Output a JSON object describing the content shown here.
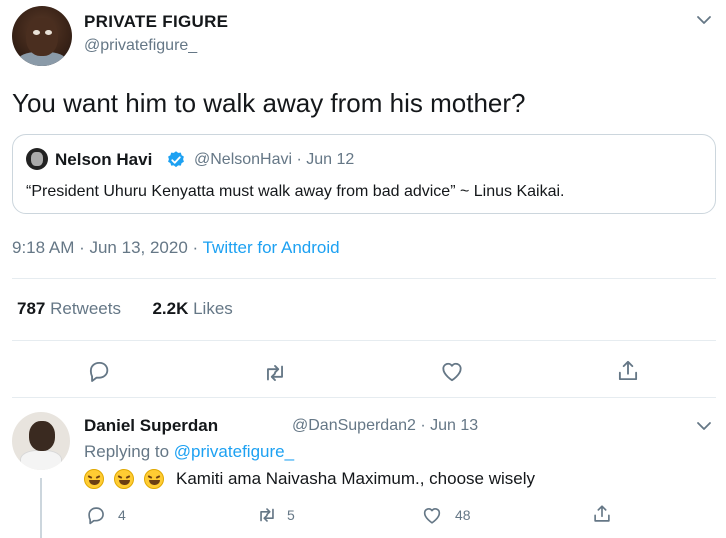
{
  "tweet": {
    "author_name": "PRIVATE FIGURE",
    "author_handle": "@privatefigure_",
    "text": "You want him to walk away from his mother?",
    "timestamp": "9:18 AM · Jun 13, 2020 · ",
    "source": "Twitter for Android",
    "retweets_count": "787",
    "retweets_label": " Retweets",
    "likes_count": "2.2K",
    "likes_label": " Likes"
  },
  "quoted_tweet": {
    "author_name": "Nelson Havi",
    "meta": "@NelsonHavi · Jun 12",
    "text": "“President Uhuru Kenyatta must walk away from bad advice” ~ Linus Kaikai."
  },
  "reply": {
    "author_name": "Daniel Superdan",
    "meta": "@DanSuperdan2 · Jun 13",
    "replying_prefix": "Replying to ",
    "replying_mention": "@privatefigure_",
    "text": "Kamiti ama Naivasha Maximum., choose wisely",
    "reply_count": "4",
    "retweet_count": "5",
    "like_count": "48"
  },
  "icons": {
    "menu": "chevron-down-icon",
    "verified": "verified-badge-icon",
    "reply": "reply-icon",
    "retweet": "retweet-icon",
    "like": "heart-icon",
    "share": "share-icon",
    "emoji": "rolling-on-floor-laughing-emoji"
  },
  "colors": {
    "accent": "#1da1f2",
    "secondary_text": "#657786",
    "divider": "#e6ecf0"
  }
}
